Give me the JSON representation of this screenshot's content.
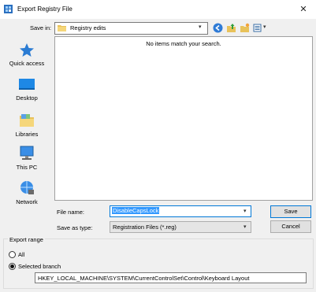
{
  "window": {
    "title": "Export Registry File",
    "close_glyph": "✕"
  },
  "save_in": {
    "label": "Save in:",
    "value": "Registry edits"
  },
  "places": [
    {
      "label": "Quick access",
      "icon": "star-icon"
    },
    {
      "label": "Desktop",
      "icon": "desktop-icon"
    },
    {
      "label": "Libraries",
      "icon": "libraries-icon"
    },
    {
      "label": "This PC",
      "icon": "computer-icon"
    },
    {
      "label": "Network",
      "icon": "network-icon"
    }
  ],
  "file_list": {
    "empty_message": "No items match your search."
  },
  "file_name": {
    "label": "File name:",
    "value": "DisableCapsLock"
  },
  "save_as_type": {
    "label": "Save as type:",
    "value": "Registration Files (*.reg)"
  },
  "buttons": {
    "save": "Save",
    "cancel": "Cancel"
  },
  "export_range": {
    "title": "Export range",
    "all_label": "All",
    "selected_label": "Selected branch",
    "selected_option": "Selected branch",
    "branch_value": "HKEY_LOCAL_MACHINE\\SYSTEM\\CurrentControlSet\\Control\\Keyboard Layout"
  },
  "colors": {
    "accent": "#0078d7",
    "selection": "#3399ff",
    "dialog_bg": "#f0f0f0"
  }
}
